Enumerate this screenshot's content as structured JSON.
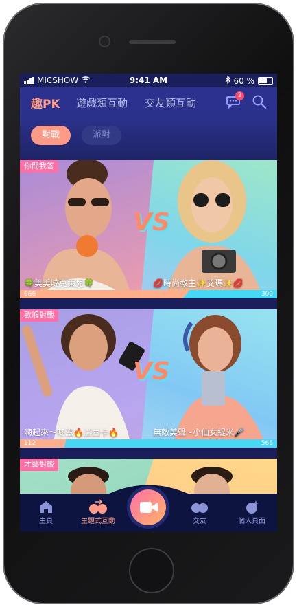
{
  "status": {
    "carrier": "MICSHOW",
    "time": "9:41 AM",
    "battery": "60 %"
  },
  "topnav": {
    "tabs": [
      {
        "label": "趣PK",
        "active": true
      },
      {
        "label": "遊戲類互動",
        "active": false
      },
      {
        "label": "交友類互動",
        "active": false
      }
    ],
    "message_badge": "2"
  },
  "subnav": {
    "battle": "對戰",
    "party": "派對"
  },
  "cards": [
    {
      "tag": "你問我答",
      "left_name": "🍀美美噠克萊兒🍀",
      "right_name": "💋時尚教主✨艾瑪✨💋",
      "left_score": "666",
      "right_score": "300",
      "left_ratio": 0.66,
      "vs": "VS"
    },
    {
      "tag": "歌喉對戰",
      "left_name": "嗨起來～咚滋🔥潔西卡🔥",
      "right_name": "無敵美聲~小仙女緹米🎤",
      "left_score": "112",
      "right_score": "566",
      "left_ratio": 0.18,
      "vs": "VS"
    },
    {
      "tag": "才藝對戰"
    }
  ],
  "bottombar": {
    "items": [
      {
        "label": "主頁",
        "icon": "home-icon"
      },
      {
        "label": "主題式互動",
        "icon": "theme-interaction-icon",
        "active": true
      },
      {
        "label": "交友",
        "icon": "friends-icon"
      },
      {
        "label": "個人頁面",
        "icon": "profile-icon"
      }
    ]
  },
  "colors": {
    "accent": "#ff9a86",
    "nav_bg": "#2c3190",
    "cyan": "#47d8f5"
  }
}
